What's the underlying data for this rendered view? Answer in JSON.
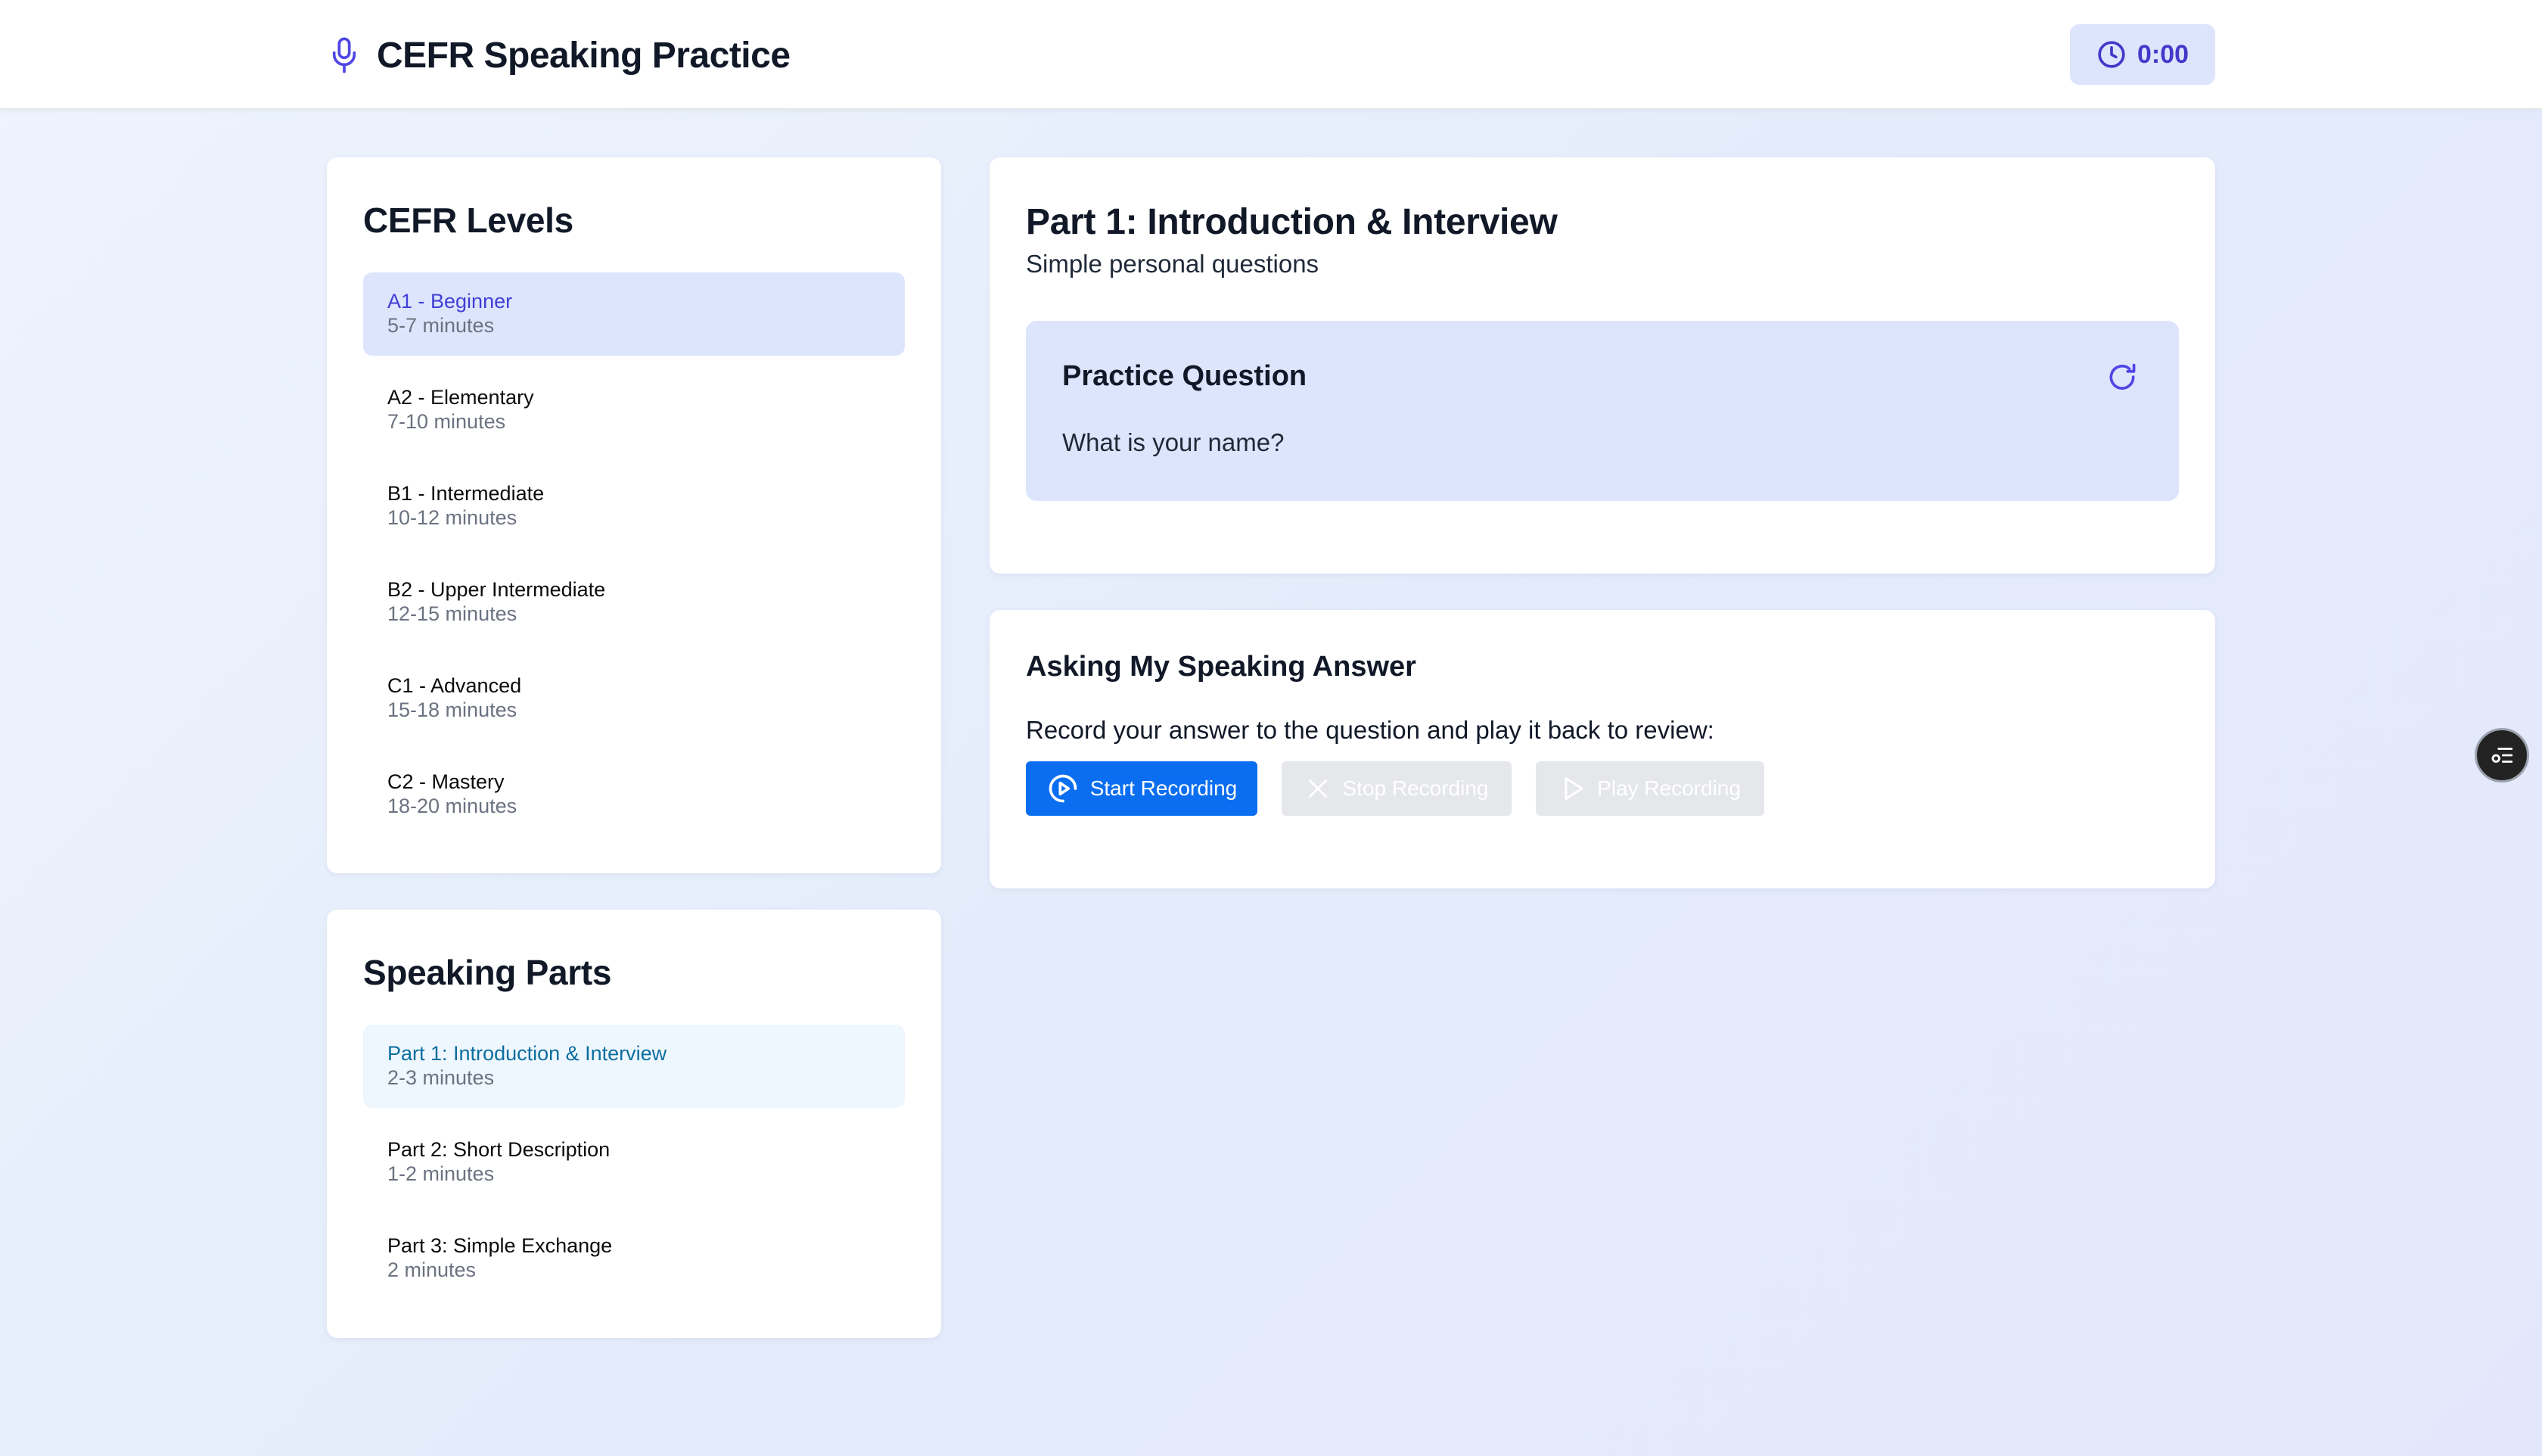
{
  "header": {
    "app_title": "CEFR Speaking Practice",
    "timer": "0:00",
    "icons": {
      "brand": "microphone-icon",
      "timer": "clock-icon"
    }
  },
  "levels": {
    "title": "CEFR Levels",
    "selected": "A1 - Beginner",
    "items": [
      {
        "label": "A1 - Beginner",
        "duration": "5-7 minutes"
      },
      {
        "label": "A2 - Elementary",
        "duration": "7-10 minutes"
      },
      {
        "label": "B1 - Intermediate",
        "duration": "10-12 minutes"
      },
      {
        "label": "B2 - Upper Intermediate",
        "duration": "12-15 minutes"
      },
      {
        "label": "C1 - Advanced",
        "duration": "15-18 minutes"
      },
      {
        "label": "C2 - Mastery",
        "duration": "18-20 minutes"
      }
    ]
  },
  "parts": {
    "title": "Speaking Parts",
    "selected": "Part 1: Introduction & Interview",
    "items": [
      {
        "label": "Part 1: Introduction & Interview",
        "duration": "2-3 minutes"
      },
      {
        "label": "Part 2: Short Description",
        "duration": "1-2 minutes"
      },
      {
        "label": "Part 3: Simple Exchange",
        "duration": "2 minutes"
      }
    ]
  },
  "question": {
    "part_title": "Part 1: Introduction & Interview",
    "part_subtitle": "Simple personal questions",
    "practice_title": "Practice Question",
    "practice_question": "What is your name?",
    "refresh_icon": "refresh-icon"
  },
  "answer": {
    "title": "Asking My Speaking Answer",
    "instructions": "Record your answer to the question and play it back to review:",
    "buttons": {
      "start": {
        "label": "Start Recording",
        "icon": "play-circle-icon",
        "enabled": true
      },
      "stop": {
        "label": "Stop Recording",
        "icon": "x-icon",
        "enabled": false
      },
      "play": {
        "label": "Play Recording",
        "icon": "play-icon",
        "enabled": false
      }
    }
  },
  "colors": {
    "accent": "#4338ca",
    "primary_button": "#0b6ef0",
    "selected_level_bg": "#dde5fd",
    "selected_part_bg": "#eef6fe",
    "disabled_button": "#e5e7eb"
  },
  "floating_widget": {
    "icon": "settings-list-icon"
  }
}
